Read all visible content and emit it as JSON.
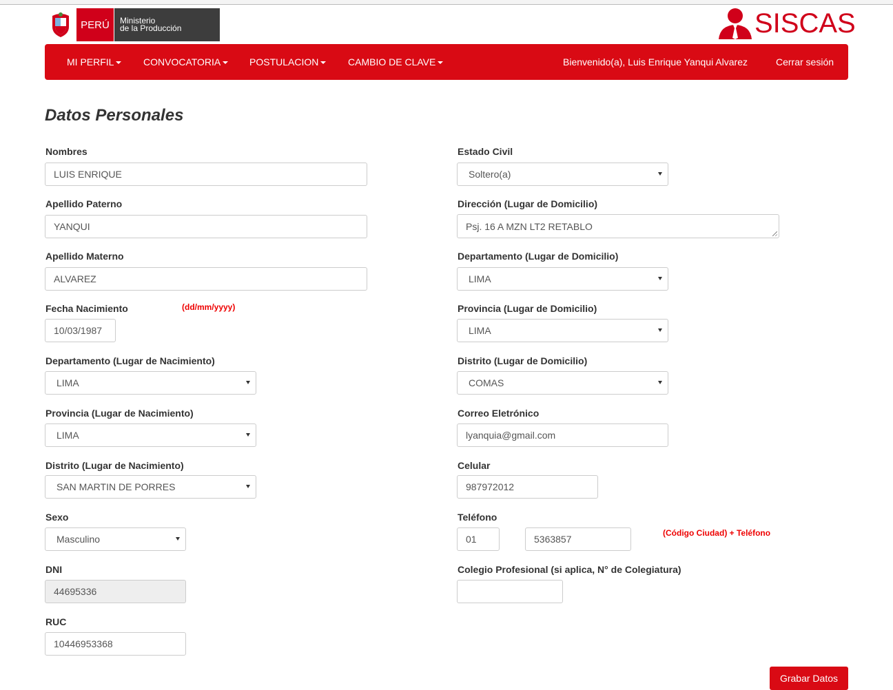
{
  "header": {
    "peru_label": "PERÚ",
    "ministry_line1": "Ministerio",
    "ministry_line2": "de la Producción",
    "app_name": "SISCAS"
  },
  "nav": {
    "items": [
      "MI PERFIL",
      "CONVOCATORIA",
      "POSTULACION",
      "CAMBIO DE CLAVE"
    ],
    "welcome": "Bienvenido(a), Luis Enrique Yanqui Alvarez",
    "logout": "Cerrar sesión"
  },
  "page_title": "Datos Personales",
  "form": {
    "nombres": {
      "label": "Nombres",
      "value": "LUIS ENRIQUE"
    },
    "apellido_paterno": {
      "label": "Apellido Paterno",
      "value": "YANQUI"
    },
    "apellido_materno": {
      "label": "Apellido Materno",
      "value": "ALVAREZ"
    },
    "fecha_nacimiento": {
      "label": "Fecha Nacimiento",
      "hint": "(dd/mm/yyyy)",
      "value": "10/03/1987"
    },
    "dep_nacimiento": {
      "label": "Departamento (Lugar de Nacimiento)",
      "value": "LIMA"
    },
    "prov_nacimiento": {
      "label": "Provincia (Lugar de Nacimiento)",
      "value": "LIMA"
    },
    "dist_nacimiento": {
      "label": "Distrito (Lugar de Nacimiento)",
      "value": "SAN MARTIN DE PORRES"
    },
    "sexo": {
      "label": "Sexo",
      "value": "Masculino"
    },
    "dni": {
      "label": "DNI",
      "value": "44695336"
    },
    "ruc": {
      "label": "RUC",
      "value": "10446953368"
    },
    "estado_civil": {
      "label": "Estado Civil",
      "value": "Soltero(a)"
    },
    "direccion": {
      "label": "Dirección (Lugar de Domicilio)",
      "value": "Psj. 16 A MZN LT2 RETABLO"
    },
    "dep_domicilio": {
      "label": "Departamento (Lugar de Domicilio)",
      "value": "LIMA"
    },
    "prov_domicilio": {
      "label": "Provincia (Lugar de Domicilio)",
      "value": "LIMA"
    },
    "dist_domicilio": {
      "label": "Distrito (Lugar de Domicilio)",
      "value": "COMAS"
    },
    "correo": {
      "label": "Correo Eletrónico",
      "value": "lyanquia@gmail.com"
    },
    "celular": {
      "label": "Celular",
      "value": "987972012"
    },
    "telefono": {
      "label": "Teléfono",
      "code": "01",
      "number": "5363857",
      "hint": "(Código Ciudad) + Teléfono"
    },
    "colegio": {
      "label": "Colegio Profesional (si aplica, N° de Colegiatura)",
      "value": ""
    }
  },
  "submit_label": "Grabar Datos",
  "colors": {
    "brand_red": "#d90a14",
    "hint_red": "#e00000",
    "dark_gray": "#3d3d3d"
  }
}
